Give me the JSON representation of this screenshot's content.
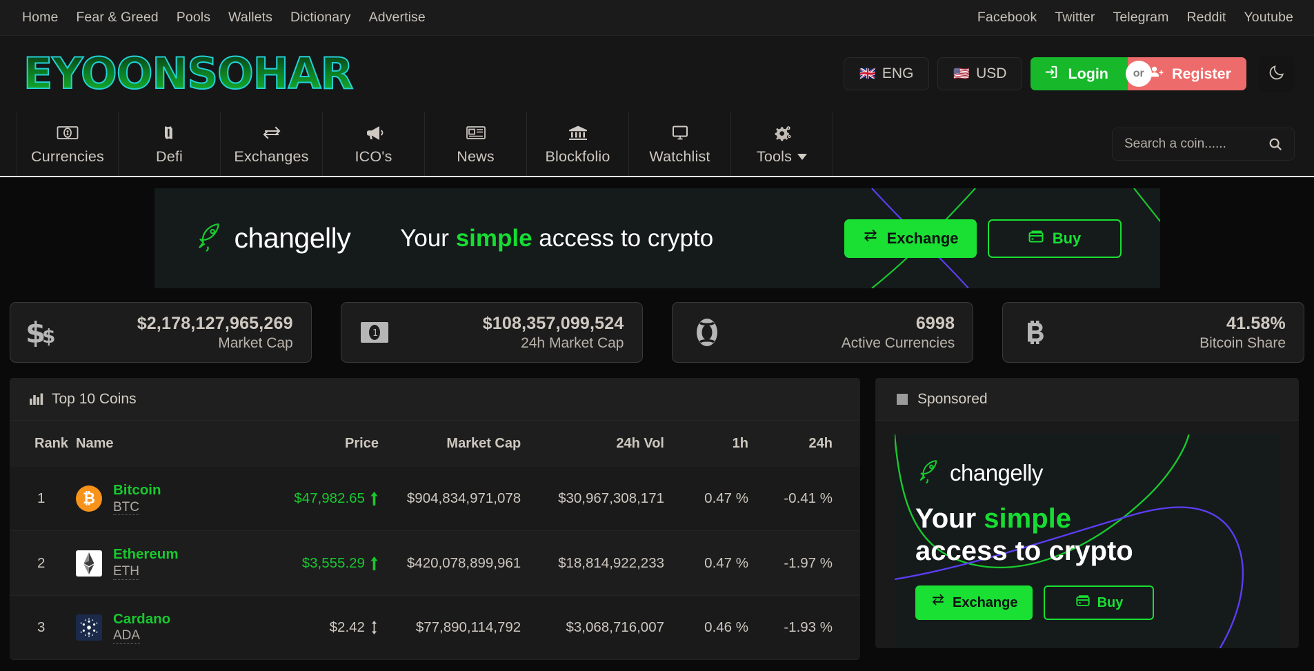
{
  "topbar": {
    "left_links": [
      "Home",
      "Fear & Greed",
      "Pools",
      "Wallets",
      "Dictionary",
      "Advertise"
    ],
    "right_links": [
      "Facebook",
      "Twitter",
      "Telegram",
      "Reddit",
      "Youtube"
    ]
  },
  "header": {
    "logo": "EYOONSOHAR",
    "language": {
      "label": "ENG",
      "flag": "🇬🇧"
    },
    "currency": {
      "label": "USD",
      "flag": "🇺🇸"
    },
    "login_label": "Login",
    "or_label": "or",
    "register_label": "Register",
    "theme_icon": "moon-icon"
  },
  "mainnav": {
    "items": [
      {
        "label": "Currencies",
        "icon": "money-bill-icon"
      },
      {
        "label": "Defi",
        "icon": "shekel-sign-icon"
      },
      {
        "label": "Exchanges",
        "icon": "exchange-arrows-icon"
      },
      {
        "label": "ICO's",
        "icon": "bullhorn-icon"
      },
      {
        "label": "News",
        "icon": "newspaper-icon"
      },
      {
        "label": "Blockfolio",
        "icon": "bank-icon"
      },
      {
        "label": "Watchlist",
        "icon": "desktop-monitor-icon"
      },
      {
        "label": "Tools",
        "icon": "cogs-icon",
        "has_dropdown": true
      }
    ],
    "search_placeholder": "Search a coin......",
    "search_value": ""
  },
  "banner": {
    "brand": "changelly",
    "tagline_pre": "Your ",
    "tagline_hl": "simple",
    "tagline_post": " access to crypto",
    "exchange_label": "Exchange",
    "buy_label": "Buy"
  },
  "stats": [
    {
      "value": "$2,178,127,965,269",
      "label": "Market Cap",
      "icon": "dollar-signs-icon"
    },
    {
      "value": "$108,357,099,524",
      "label": "24h Market Cap",
      "icon": "money-bill-icon"
    },
    {
      "value": "6998",
      "label": "Active Currencies",
      "icon": "life-ring-icon"
    },
    {
      "value": "41.58%",
      "label": "Bitcoin Share",
      "icon": "bitcoin-icon"
    }
  ],
  "top_coins": {
    "title": "Top 10 Coins",
    "icon": "chart-bar-icon",
    "headers": {
      "rank": "Rank",
      "name": "Name",
      "price": "Price",
      "market_cap": "Market Cap",
      "vol24h": "24h Vol",
      "h1": "1h",
      "h24": "24h"
    },
    "rows": [
      {
        "rank": "1",
        "name": "Bitcoin",
        "symbol": "BTC",
        "price": "$47,982.65",
        "price_dir": "up",
        "market_cap": "$904,834,971,078",
        "vol24h": "$30,967,308,171",
        "h1": "0.47 %",
        "h1_dir": "up",
        "h24": "-0.41 %",
        "h24_dir": "down"
      },
      {
        "rank": "2",
        "name": "Ethereum",
        "symbol": "ETH",
        "price": "$3,555.29",
        "price_dir": "up",
        "market_cap": "$420,078,899,961",
        "vol24h": "$18,814,922,233",
        "h1": "0.47 %",
        "h1_dir": "up",
        "h24": "-1.97 %",
        "h24_dir": "down"
      },
      {
        "rank": "3",
        "name": "Cardano",
        "symbol": "ADA",
        "price": "$2.42",
        "price_dir": "neutral",
        "market_cap": "$77,890,114,792",
        "vol24h": "$3,068,716,007",
        "h1": "0.46 %",
        "h1_dir": "up",
        "h24": "-1.93 %",
        "h24_dir": "down"
      }
    ]
  },
  "sponsored": {
    "title": "Sponsored",
    "brand": "changelly",
    "tagline_pre": "Your ",
    "tagline_hl": "simple",
    "tagline_post": "access to crypto",
    "exchange_label": "Exchange",
    "buy_label": "Buy"
  },
  "colors": {
    "accent_green": "#19c82f",
    "bright_green": "#19e033",
    "down_red": "#f02a2a",
    "register_red": "#ee6b6b",
    "bitcoin_orange": "#f7931a",
    "logo_cyan": "#22cfd6",
    "purple_line": "#5b3df0"
  }
}
